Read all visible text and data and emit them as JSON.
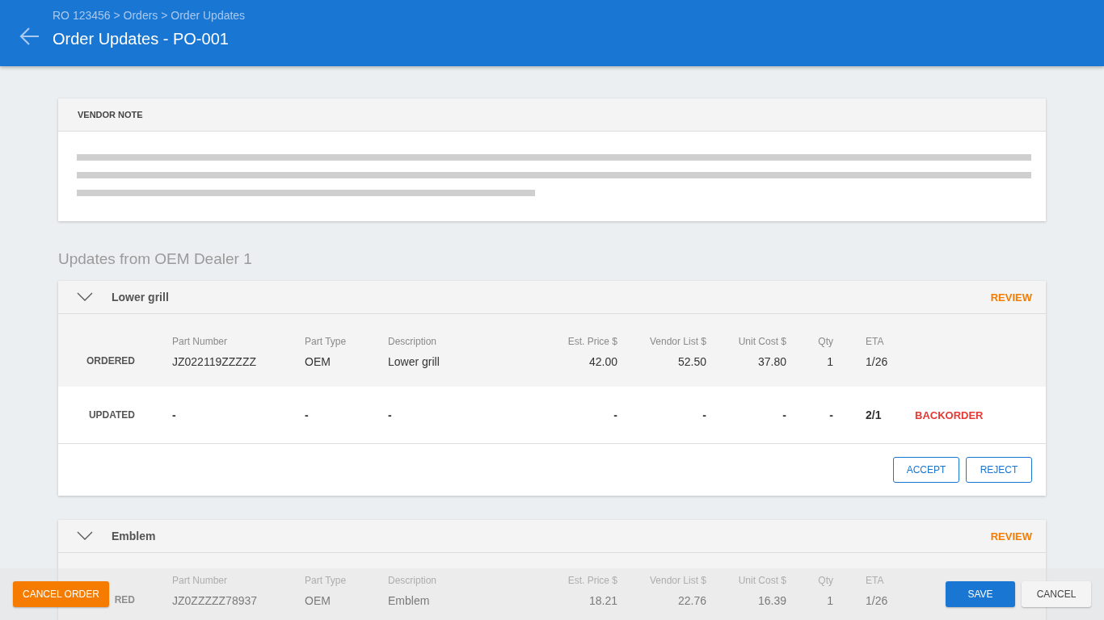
{
  "header": {
    "breadcrumb": "RO 123456 > Orders > Order Updates",
    "title": "Order Updates - PO-001"
  },
  "vendor_note": {
    "title": "VENDOR NOTE"
  },
  "section_title": "Updates from OEM Dealer 1",
  "items": [
    {
      "name": "Lower grill",
      "status": "REVIEW",
      "expanded": true,
      "columns": [
        "Part Number",
        "Part Type",
        "Description",
        "Est. Price $",
        "Vendor List $",
        "Unit Cost $",
        "Qty",
        "ETA"
      ],
      "rows": [
        {
          "kind": "ordered",
          "label": "ORDERED",
          "cells": [
            "JZ022119ZZZZZ",
            "OEM",
            "Lower grill",
            "42.00",
            "52.50",
            "37.80",
            "1",
            "1/26"
          ]
        },
        {
          "kind": "updated",
          "label": "UPDATED",
          "cells": [
            "-",
            "-",
            "-",
            "-",
            "-",
            "-",
            "-",
            "2/1"
          ],
          "flag": "BACKORDER"
        }
      ],
      "actions": [
        "ACCEPT",
        "REJECT"
      ]
    },
    {
      "name": "Emblem",
      "status": "REVIEW",
      "expanded": true,
      "columns": [
        "Part Number",
        "Part Type",
        "Description",
        "Est. Price $",
        "Vendor List $",
        "Unit Cost $",
        "Qty",
        "ETA"
      ],
      "rows": [
        {
          "kind": "ordered",
          "label": "RED",
          "cells": [
            "JZ0ZZZZZ78937",
            "OEM",
            "Emblem",
            "18.21",
            "22.76",
            "16.39",
            "1",
            "1/26"
          ]
        }
      ]
    }
  ],
  "footer": {
    "buttons": [
      {
        "label": "CANCEL ORDER",
        "kind": "danger"
      },
      {
        "label": "SAVE",
        "kind": "primary"
      },
      {
        "label": "CANCEL",
        "kind": "secondary"
      }
    ]
  }
}
